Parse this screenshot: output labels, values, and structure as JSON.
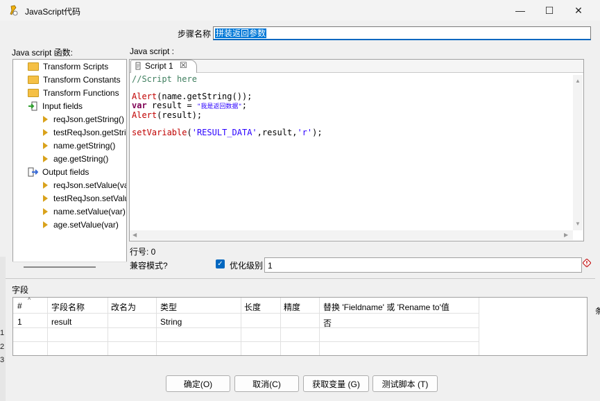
{
  "window": {
    "title": "JavaScript代码",
    "minimize_glyph": "—",
    "maximize_glyph": "☐",
    "close_glyph": "✕"
  },
  "step": {
    "label": "步骤名称",
    "value": "拼装返回参数"
  },
  "functions_panel": {
    "label": "Java script 函数:",
    "items": [
      {
        "label": "Transform Scripts",
        "icon": "folder-icon"
      },
      {
        "label": "Transform Constants",
        "icon": "folder-icon"
      },
      {
        "label": "Transform Functions",
        "icon": "folder-icon"
      },
      {
        "label": "Input fields",
        "icon": "input-fields-icon"
      },
      {
        "label": "reqJson.getString()",
        "icon": "field-arrow-icon"
      },
      {
        "label": "testReqJson.getString()",
        "icon": "field-arrow-icon"
      },
      {
        "label": "name.getString()",
        "icon": "field-arrow-icon"
      },
      {
        "label": "age.getString()",
        "icon": "field-arrow-icon"
      },
      {
        "label": "Output fields",
        "icon": "output-fields-icon"
      },
      {
        "label": "reqJson.setValue(var)",
        "icon": "field-arrow-icon"
      },
      {
        "label": "testReqJson.setValue(var)",
        "icon": "field-arrow-icon"
      },
      {
        "label": "name.setValue(var)",
        "icon": "field-arrow-icon"
      },
      {
        "label": "age.setValue(var)",
        "icon": "field-arrow-icon"
      }
    ]
  },
  "editor": {
    "label": "Java script :",
    "tab_label": "Script 1",
    "tab_close": "☒",
    "code": {
      "comment": "//Script here",
      "line_alert1": {
        "fn": "Alert",
        "rest": "(name.getString());"
      },
      "line_var": {
        "kw": "var",
        "mid": " result = ",
        "str": "\"我是返回数据\"",
        "end": ";"
      },
      "line_alert2": {
        "fn": "Alert",
        "rest": "(result);"
      },
      "line_setvar": {
        "fn": "setVariable",
        "open": "(",
        "s1": "'RESULT_DATA'",
        "mid": ",result,",
        "s2": "'r'",
        "end": ");"
      }
    }
  },
  "status": {
    "line_number": "行号: 0",
    "compat_label": "兼容模式?",
    "optimize_label": "优化级别",
    "optimize_value": "1",
    "compat_checked": true
  },
  "fields": {
    "label": "字段",
    "columns": [
      "#",
      "字段名称",
      "改名为",
      "类型",
      "长度",
      "精度",
      "替换 'Fieldname' 或 'Rename to'值"
    ],
    "rows": [
      [
        "1",
        "result",
        "",
        "String",
        "",
        "",
        "否"
      ]
    ]
  },
  "buttons": {
    "ok": "确定(O)",
    "cancel": "取消(C)",
    "get_vars": "获取变量 (G)",
    "test": "测试脚本 (T)"
  },
  "background_fragments": {
    "left_numbers": [
      "1",
      "2",
      "3"
    ],
    "right_text": "条"
  }
}
